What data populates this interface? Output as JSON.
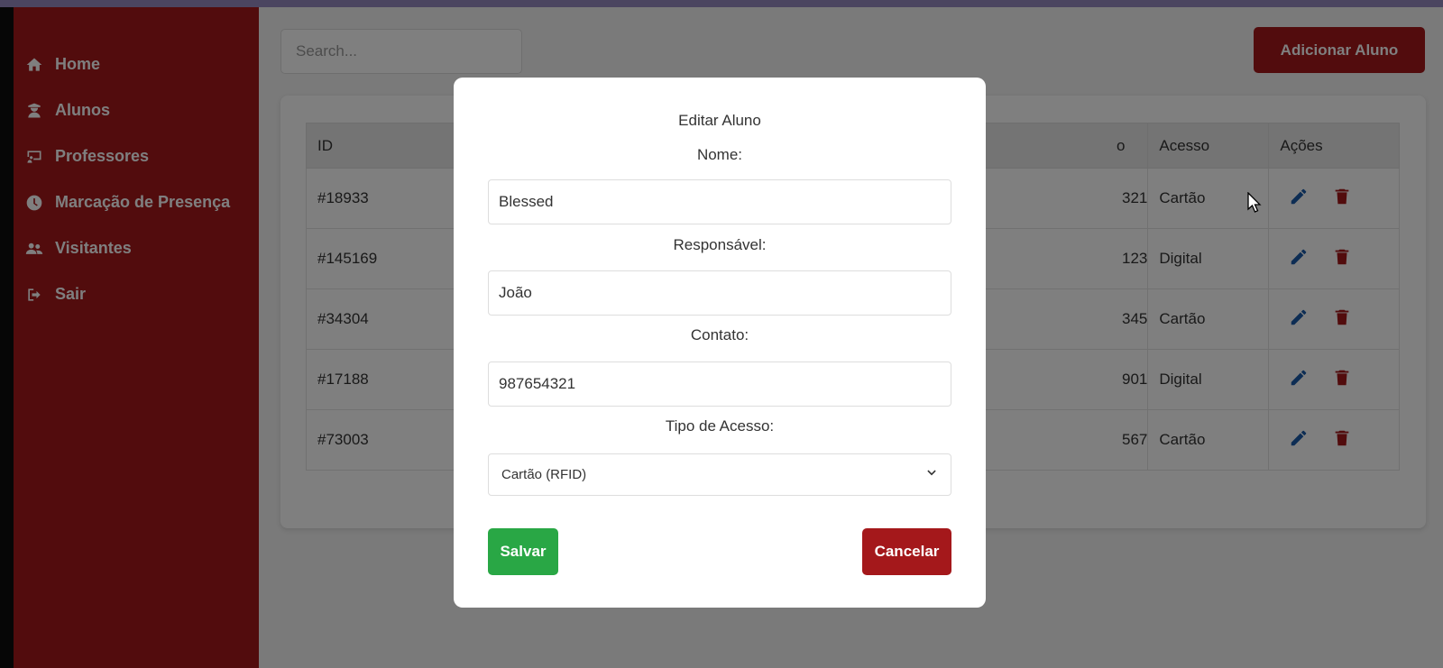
{
  "sidebar": {
    "items": [
      {
        "label": "Home",
        "icon": "home-icon"
      },
      {
        "label": "Alunos",
        "icon": "student-icon"
      },
      {
        "label": "Professores",
        "icon": "teacher-board-icon"
      },
      {
        "label": "Marcação de Presença",
        "icon": "clock-icon"
      },
      {
        "label": "Visitantes",
        "icon": "users-icon"
      },
      {
        "label": "Sair",
        "icon": "sign-out-icon"
      }
    ]
  },
  "search": {
    "placeholder": "Search..."
  },
  "add_button": {
    "label": "Adicionar Aluno"
  },
  "table": {
    "headers": {
      "id": "ID",
      "contato_partial": "o",
      "acesso": "Acesso",
      "acoes": "Ações"
    },
    "rows": [
      {
        "id": "#18933",
        "contato_partial": "321",
        "acesso": "Cartão"
      },
      {
        "id": "#145169",
        "contato_partial": "123",
        "acesso": "Digital"
      },
      {
        "id": "#34304",
        "contato_partial": "345",
        "acesso": "Cartão"
      },
      {
        "id": "#17188",
        "contato_partial": "901",
        "acesso": "Digital"
      },
      {
        "id": "#73003",
        "contato_partial": "567",
        "acesso": "Cartão"
      }
    ]
  },
  "modal": {
    "title": "Editar Aluno",
    "nome_label": "Nome:",
    "nome_value": "Blessed",
    "responsavel_label": "Responsável:",
    "responsavel_value": "João",
    "contato_label": "Contato:",
    "contato_value": "987654321",
    "tipo_label": "Tipo de Acesso:",
    "tipo_value": "Cartão (RFID)",
    "save_label": "Salvar",
    "cancel_label": "Cancelar"
  },
  "colors": {
    "primary_red": "#a4181b",
    "edit_blue": "#1a5ba8",
    "save_green": "#29a745"
  }
}
